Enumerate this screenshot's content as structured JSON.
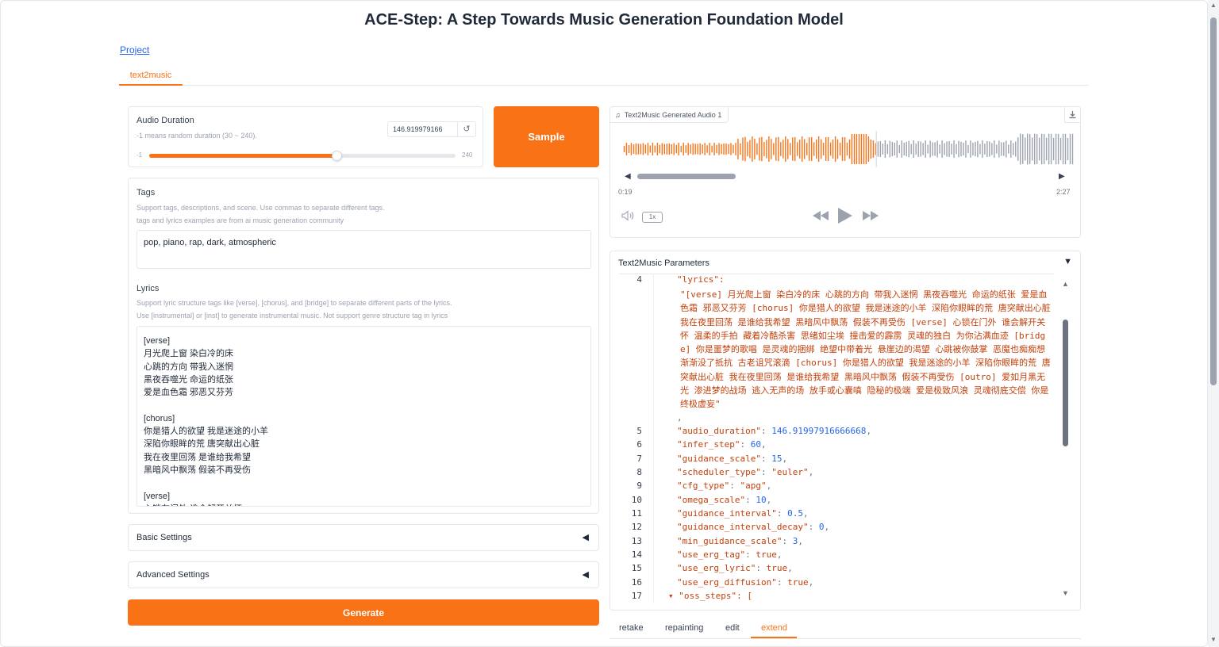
{
  "header": {
    "title": "ACE-Step: A Step Towards Music Generation Foundation Model",
    "project_link": "Project"
  },
  "tabs": {
    "active": "text2music"
  },
  "duration": {
    "label": "Audio Duration",
    "hint": "-1 means random duration (30 ~ 240).",
    "value": "146.919979166",
    "min": "-1",
    "max": "240",
    "level_fraction": 0.612
  },
  "sample_button": "Sample",
  "tags": {
    "label": "Tags",
    "hint1": "Support tags, descriptions, and scene. Use commas to separate different tags.",
    "hint2": "tags and lyrics examples are from ai music generation community",
    "value": "pop, piano, rap, dark, atmospheric"
  },
  "lyrics": {
    "label": "Lyrics",
    "hint1": "Support lyric structure tags like [verse], [chorus], and [bridge] to separate different parts of the lyrics.",
    "hint2": "Use [instrumental] or [inst] to generate instrumental music. Not support genre structure tag in lyrics",
    "lines": [
      "[verse]",
      "月光爬上窗 染白冷的床",
      "心跳的方向 带我入迷惘",
      "黑夜吞噬光 命运的纸张",
      "爱是血色霜 邪恶又芬芳",
      "",
      "[chorus]",
      "你是猎人的欲望 我是迷途的小羊",
      "深陷你眼眸的荒 唐突献出心脏",
      "我在夜里回荡 是谁给我希望",
      "黑暗风中飘荡 假装不再受伤",
      "",
      "[verse]",
      "心锁在门外 谁会解开关怀"
    ]
  },
  "accordions": {
    "basic": "Basic Settings",
    "advanced": "Advanced Settings"
  },
  "generate_button": "Generate",
  "audio": {
    "title": "Text2Music Generated Audio 1",
    "current_time": "0:19",
    "total_time": "2:27",
    "rate": "1x",
    "progress_fraction": 0.562
  },
  "params": {
    "title": "Text2Music Parameters",
    "line_numbers": [
      "4",
      "5",
      "6",
      "7",
      "8",
      "9",
      "10",
      "11",
      "12",
      "13",
      "14",
      "15",
      "16",
      "17"
    ],
    "lyrics_key": "\"lyrics\":",
    "lyrics_value": "\"[verse] 月光爬上窗 染白冷的床 心跳的方向 带我入迷惘 黑夜吞噬光 命运的纸张 爱是血色霜 邪恶又芬芳 [chorus] 你是猎人的欲望 我是迷途的小羊 深陷你眼眸的荒 唐突献出心脏 我在夜里回荡 是谁给我希望 黑暗风中飘荡 假装不再受伤 [verse] 心锁在门外 谁会解开关怀 温柔的手拍 藏着冷酷杀害 思绪如尘埃 撞击爱的霹雳 灵魂的独白 为你沾满血迹 [bridge] 你是噩梦的歌唱 是灵魂的捆绑 绝望中带着光 悬崖边的渴望 心跳被你鼓掌 恶魔也痴痴想 渐渐没了抵抗 古老诅咒滚滴 [chorus] 你是猎人的欲望 我是迷途的小羊 深陷你眼眸的荒 唐突献出心脏 我在夜里回荡 是谁给我希望 黑暗风中飘荡 假装不再受伤 [outro] 爱如月黑无光 渗进梦的战场 逃入无声的场 放手或心囊嗔 隐秘的极端 爱是极致风浪 灵魂彻底交偿 你是终极虚妄\"",
    "comma": ",",
    "entries": [
      {
        "key": "\"audio_duration\"",
        "value": "146.91997916666668",
        "kind": "num"
      },
      {
        "key": "\"infer_step\"",
        "value": "60",
        "kind": "num"
      },
      {
        "key": "\"guidance_scale\"",
        "value": "15",
        "kind": "num"
      },
      {
        "key": "\"scheduler_type\"",
        "value": "\"euler\"",
        "kind": "str"
      },
      {
        "key": "\"cfg_type\"",
        "value": "\"apg\"",
        "kind": "str"
      },
      {
        "key": "\"omega_scale\"",
        "value": "10",
        "kind": "num"
      },
      {
        "key": "\"guidance_interval\"",
        "value": "0.5",
        "kind": "num"
      },
      {
        "key": "\"guidance_interval_decay\"",
        "value": "0",
        "kind": "num"
      },
      {
        "key": "\"min_guidance_scale\"",
        "value": "3",
        "kind": "num"
      },
      {
        "key": "\"use_erg_tag\"",
        "value": "true",
        "kind": "kw"
      },
      {
        "key": "\"use_erg_lyric\"",
        "value": "true",
        "kind": "kw"
      },
      {
        "key": "\"use_erg_diffusion\"",
        "value": "true",
        "kind": "kw"
      }
    ],
    "last_line": "\"oss_steps\": ["
  },
  "bottom_tabs": {
    "retake": "retake",
    "repainting": "repainting",
    "edit": "edit",
    "extend": "extend"
  },
  "colors": {
    "accent": "#f97316",
    "link": "#2563eb",
    "wave_played": "#f97316",
    "wave_unplayed": "#9ca3af"
  }
}
